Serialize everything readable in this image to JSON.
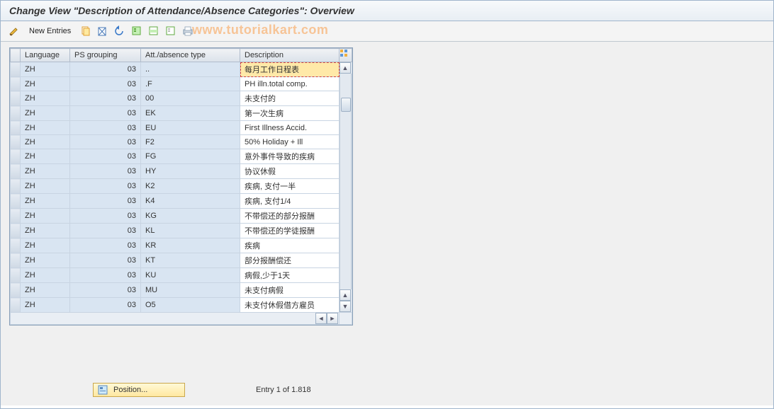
{
  "title": "Change View \"Description of Attendance/Absence Categories\": Overview",
  "toolbar": {
    "new_entries": "New Entries"
  },
  "watermark": "www.tutorialkart.com",
  "columns": {
    "language": "Language",
    "ps_grouping": "PS grouping",
    "att_type": "Att./absence type",
    "description": "Description"
  },
  "rows": [
    {
      "lang": "ZH",
      "ps": "03",
      "attype": "..",
      "desc": "每月工作日程表",
      "selected": true
    },
    {
      "lang": "ZH",
      "ps": "03",
      "attype": ".F",
      "desc": "PH illn.total comp."
    },
    {
      "lang": "ZH",
      "ps": "03",
      "attype": "00",
      "desc": "未支付的"
    },
    {
      "lang": "ZH",
      "ps": "03",
      "attype": "EK",
      "desc": "第一次生病"
    },
    {
      "lang": "ZH",
      "ps": "03",
      "attype": "EU",
      "desc": "First Illness Accid."
    },
    {
      "lang": "ZH",
      "ps": "03",
      "attype": "F2",
      "desc": " 50% Holiday + Ill"
    },
    {
      "lang": "ZH",
      "ps": "03",
      "attype": "FG",
      "desc": "意外事件导致的疾病"
    },
    {
      "lang": "ZH",
      "ps": "03",
      "attype": "HY",
      "desc": "协议休假"
    },
    {
      "lang": "ZH",
      "ps": "03",
      "attype": "K2",
      "desc": "疾病, 支付一半"
    },
    {
      "lang": "ZH",
      "ps": "03",
      "attype": "K4",
      "desc": "疾病, 支付1/4"
    },
    {
      "lang": "ZH",
      "ps": "03",
      "attype": "KG",
      "desc": "不带偿还的部分报酬"
    },
    {
      "lang": "ZH",
      "ps": "03",
      "attype": "KL",
      "desc": "不带偿还的学徒报酬"
    },
    {
      "lang": "ZH",
      "ps": "03",
      "attype": "KR",
      "desc": "疾病"
    },
    {
      "lang": "ZH",
      "ps": "03",
      "attype": "KT",
      "desc": "部分报酬偿还"
    },
    {
      "lang": "ZH",
      "ps": "03",
      "attype": "KU",
      "desc": "病假,少于1天"
    },
    {
      "lang": "ZH",
      "ps": "03",
      "attype": "MU",
      "desc": "未支付病假"
    },
    {
      "lang": "ZH",
      "ps": "03",
      "attype": "O5",
      "desc": "未支付休假借方雇员"
    }
  ],
  "footer": {
    "position_label": "Position...",
    "entry_text": "Entry 1 of 1.818"
  }
}
